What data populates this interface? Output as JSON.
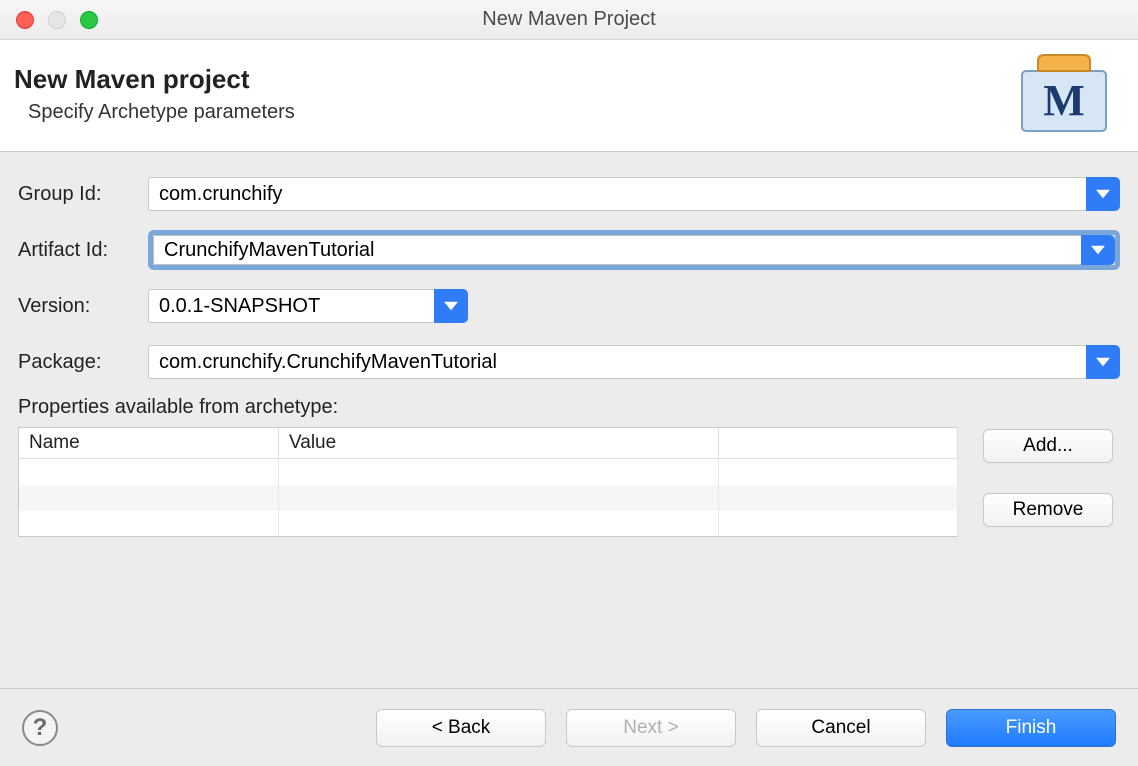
{
  "window": {
    "title": "New Maven Project"
  },
  "banner": {
    "heading": "New Maven project",
    "subheading": "Specify Archetype parameters",
    "icon_letter": "M"
  },
  "form": {
    "group_id_label": "Group Id:",
    "group_id_value": "com.crunchify",
    "artifact_id_label": "Artifact Id:",
    "artifact_id_value": "CrunchifyMavenTutorial",
    "artifact_id_focused": true,
    "version_label": "Version:",
    "version_value": "0.0.1-SNAPSHOT",
    "package_label": "Package:",
    "package_value": "com.crunchify.CrunchifyMavenTutorial"
  },
  "properties": {
    "section_label": "Properties available from archetype:",
    "columns": {
      "name": "Name",
      "value": "Value"
    },
    "rows": [],
    "add_button": "Add...",
    "remove_button": "Remove"
  },
  "footer": {
    "back": "< Back",
    "next": "Next >",
    "next_enabled": false,
    "cancel": "Cancel",
    "finish": "Finish"
  },
  "colors": {
    "accent": "#2f7cf6",
    "focus_ring": "#7aa7d9"
  }
}
